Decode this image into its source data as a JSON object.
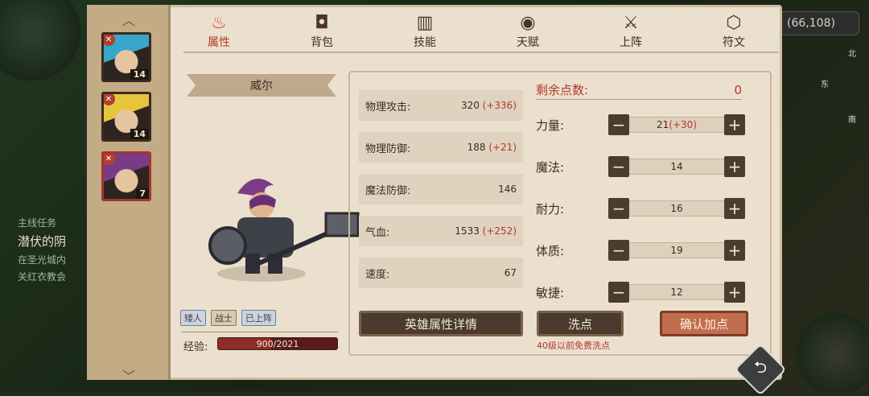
{
  "background": {
    "coordinates": "(66,108)",
    "compass": {
      "north": "北",
      "east": "东",
      "south": "南"
    },
    "quest_title": "主线任务",
    "quest_name": "潜伏的阴",
    "quest_line1": "在圣光城内",
    "quest_line2": "关红衣教会"
  },
  "sidebar": {
    "heroes": [
      {
        "level": "14",
        "color": "#38a6c8"
      },
      {
        "level": "14",
        "color": "#e6c53b"
      },
      {
        "level": "7",
        "color": "#7a3b86"
      }
    ]
  },
  "tabs": [
    {
      "label": "属性",
      "icon": "flame-icon",
      "active": true
    },
    {
      "label": "背包",
      "icon": "bag-icon",
      "active": false
    },
    {
      "label": "技能",
      "icon": "book-icon",
      "active": false
    },
    {
      "label": "天赋",
      "icon": "eye-icon",
      "active": false
    },
    {
      "label": "上阵",
      "icon": "swords-icon",
      "active": false
    },
    {
      "label": "符文",
      "icon": "rune-icon",
      "active": false
    }
  ],
  "hero": {
    "name": "威尔",
    "tags": [
      "矮人",
      "战士",
      "已上阵"
    ],
    "exp_label": "经验:",
    "exp_value": "900/2021",
    "exp_fraction": 0.445
  },
  "stats": [
    {
      "label": "物理攻击:",
      "base": "320",
      "bonus": "(+336)"
    },
    {
      "label": "物理防御:",
      "base": "188",
      "bonus": "(+21)"
    },
    {
      "label": "魔法防御:",
      "base": "146",
      "bonus": ""
    },
    {
      "label": "气血:",
      "base": "1533",
      "bonus": "(+252)"
    },
    {
      "label": "速度:",
      "base": "67",
      "bonus": ""
    }
  ],
  "points": {
    "remaining_label": "剩余点数:",
    "remaining_value": "0"
  },
  "attributes": [
    {
      "label": "力量:",
      "base": "21",
      "bonus": "(+30)"
    },
    {
      "label": "魔法:",
      "base": "14",
      "bonus": ""
    },
    {
      "label": "耐力:",
      "base": "16",
      "bonus": ""
    },
    {
      "label": "体质:",
      "base": "19",
      "bonus": ""
    },
    {
      "label": "敏捷:",
      "base": "12",
      "bonus": ""
    }
  ],
  "buttons": {
    "details": "英雄属性详情",
    "reset": "洗点",
    "confirm": "确认加点",
    "reset_note": "40级以前免费洗点"
  }
}
